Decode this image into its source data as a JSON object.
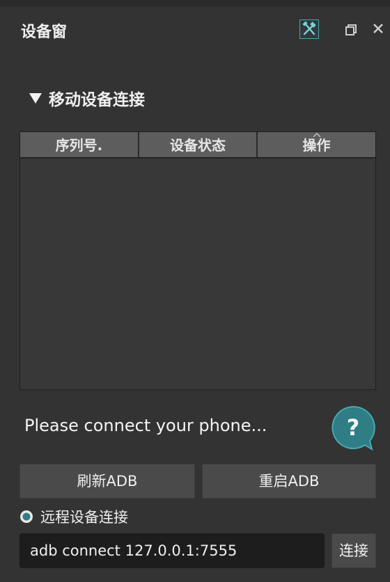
{
  "window": {
    "title": "设备窗",
    "icons": {
      "tool": "tools-icon",
      "float": "restore-icon",
      "close": "close-icon"
    },
    "accent_color": "#47a6b0"
  },
  "section": {
    "label": "移动设备连接",
    "expanded": true
  },
  "table": {
    "columns": [
      "序列号.",
      "设备状态",
      "操作"
    ],
    "rows": []
  },
  "status": {
    "message": "Please connect your phone...",
    "help_glyph": "?"
  },
  "buttons": {
    "refresh": "刷新ADB",
    "restart": "重启ADB",
    "connect": "连接"
  },
  "remote": {
    "label": "远程设备连接",
    "command_value": "adb connect 127.0.0.1:7555"
  }
}
